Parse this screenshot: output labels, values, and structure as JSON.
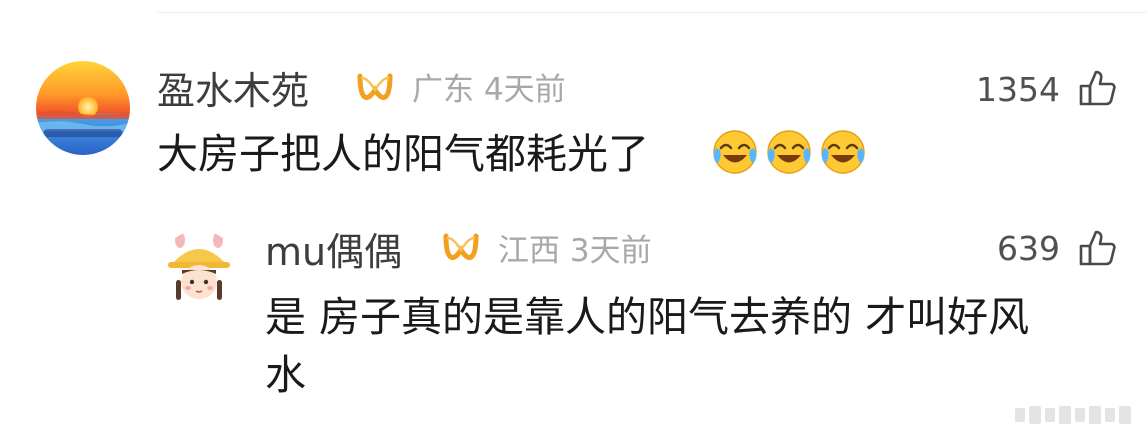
{
  "comment": {
    "username": "盈水木苑",
    "badge_icon": "vip-badge-icon",
    "location": "广东",
    "time": "4天前",
    "likes": "1354",
    "text": "大房子把人的阳气都耗光了",
    "emojis": [
      "laugh-cry-emoji",
      "laugh-cry-emoji",
      "laugh-cry-emoji"
    ]
  },
  "reply": {
    "username": "mu偶偶",
    "badge_icon": "vip-badge-icon",
    "location": "江西",
    "time": "3天前",
    "likes": "639",
    "text_line1": "是 房子真的是靠人的阳气去养的 才叫好风",
    "text_line2": "水"
  },
  "colors": {
    "badge_orange": "#f3a020",
    "username_gray": "#3d3d3d",
    "meta_gray": "#a8a8a8",
    "text_black": "#1a1a1a"
  }
}
